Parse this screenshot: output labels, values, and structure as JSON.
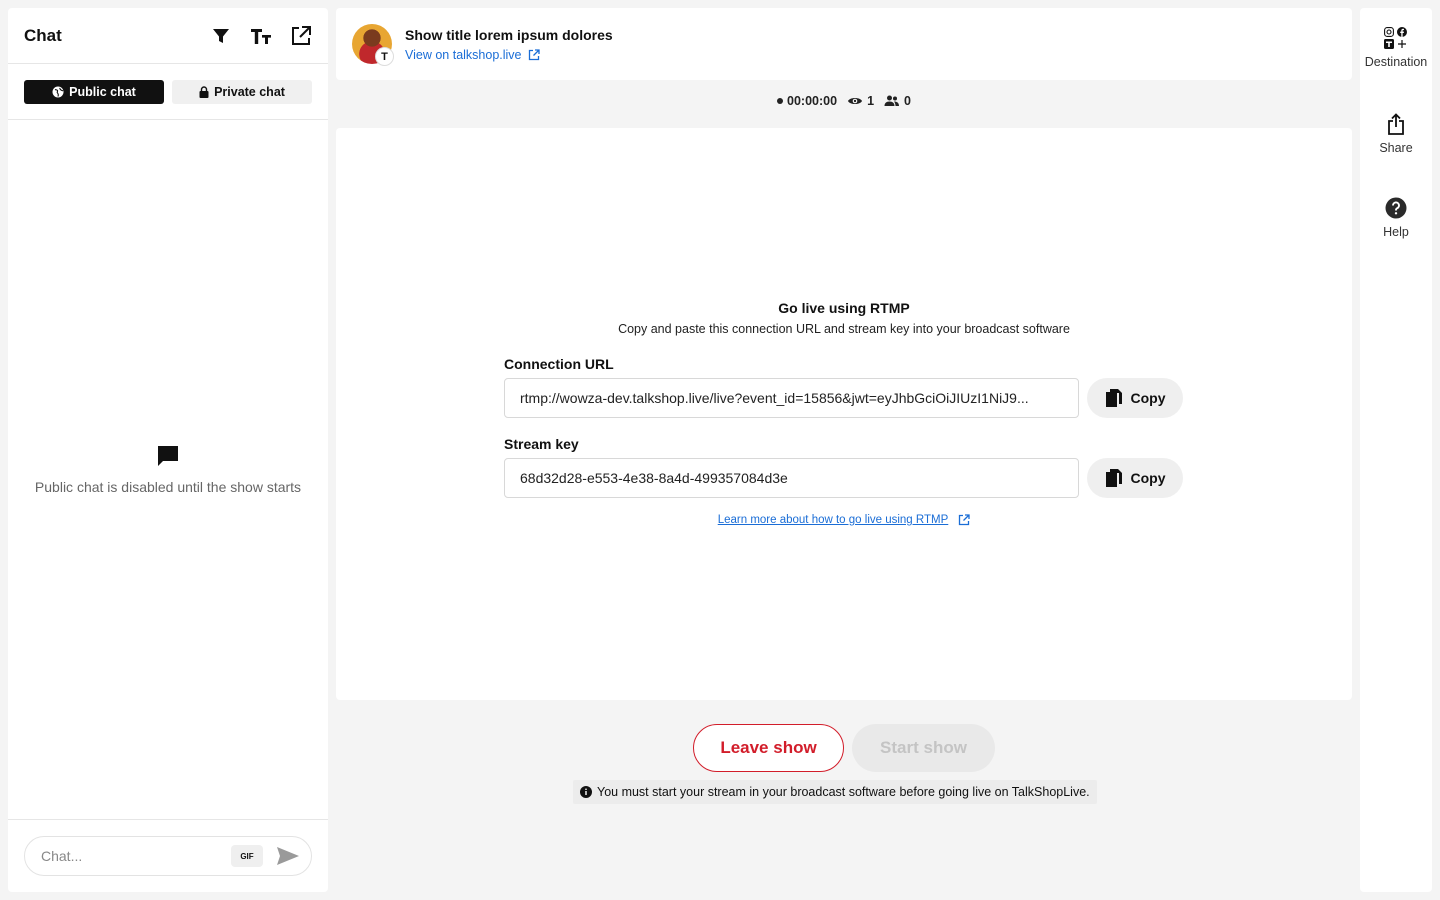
{
  "chat": {
    "title": "Chat",
    "tabs": [
      {
        "label": "Public chat",
        "active": true,
        "icon": "globe-icon"
      },
      {
        "label": "Private chat",
        "active": false,
        "icon": "lock-icon"
      }
    ],
    "empty_message": "Public chat is disabled until the show starts",
    "input_placeholder": "Chat...",
    "gif_label": "GIF"
  },
  "show": {
    "title": "Show title lorem ipsum dolores",
    "link_text": "View on talkshop.live",
    "badge_letter": "T"
  },
  "stats": {
    "timer": "00:00:00",
    "viewers": "1",
    "participants": "0"
  },
  "rtmp": {
    "title": "Go live using RTMP",
    "subtitle": "Copy and paste this connection URL and stream key into your broadcast software",
    "connection_label": "Connection URL",
    "connection_value": "rtmp://wowza-dev.talkshop.live/live?event_id=15856&jwt=eyJhbGciOiJIUzI1NiJ9...",
    "stream_label": "Stream key",
    "stream_value": "68d32d28-e553-4e38-8a4d-499357084d3e",
    "copy_label": "Copy",
    "learn_link": "Learn more about how to go live using RTMP"
  },
  "actions": {
    "leave": "Leave show",
    "start": "Start show",
    "notice": "You must start your stream in your broadcast software before going live on TalkShopLive."
  },
  "rail": {
    "destination": "Destination",
    "share": "Share",
    "help": "Help"
  },
  "colors": {
    "accent_red": "#d21d2a",
    "link_blue": "#1a6dd6",
    "dark": "#111111"
  }
}
